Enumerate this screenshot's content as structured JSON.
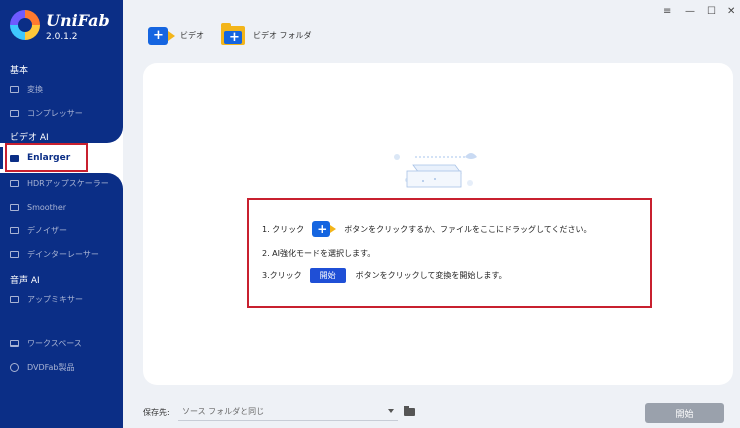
{
  "app": {
    "name": "UniFab",
    "version": "2.0.1.2"
  },
  "sidebar": {
    "sections": [
      {
        "title": "基本",
        "items": [
          {
            "label": "変換"
          },
          {
            "label": "コンプレッサー"
          }
        ]
      },
      {
        "title": "ビデオ AI",
        "items": [
          {
            "label": "Enlarger",
            "active": true
          },
          {
            "label": "HDRアップスケーラー"
          },
          {
            "label": "Smoother"
          },
          {
            "label": "デノイザー"
          },
          {
            "label": "デインターレーサー"
          }
        ]
      },
      {
        "title": "音声 AI",
        "items": [
          {
            "label": "アップミキサー"
          }
        ]
      }
    ],
    "bottom": [
      {
        "label": "ワークスペース"
      },
      {
        "label": "DVDFab製品"
      }
    ]
  },
  "toolbar": {
    "video_label": "ビデオ",
    "folder_label": "ビデオ フォルダ"
  },
  "window_controls": {
    "menu": "≡",
    "minimize": "—",
    "maximize": "☐",
    "close": "✕"
  },
  "instructions": {
    "step1_prefix": "1. クリック",
    "step1_suffix": "ボタンをクリックするか、ファイルをここにドラッグしてください。",
    "step2": "2. AI強化モードを選択します。",
    "step3_prefix": "3.クリック",
    "step3_button": "開始",
    "step3_suffix": "ボタンをクリックして変換を開始します。"
  },
  "footer": {
    "save_label": "保存先:",
    "save_value": "ソース フォルダと同じ",
    "start_button": "開始"
  },
  "colors": {
    "sidebar": "#0b2e86",
    "accent": "#1565e0",
    "highlight": "#c8202f",
    "folder": "#f3b51a"
  }
}
